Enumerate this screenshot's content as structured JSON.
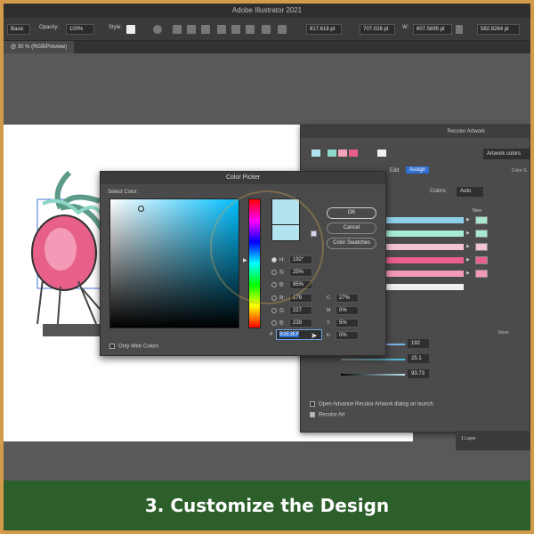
{
  "app": {
    "title": "Adobe Illustrator 2021"
  },
  "control_bar": {
    "brush_label": "Basic",
    "opacity_label": "Opacity:",
    "opacity_value": "100%",
    "style_label": "Style:",
    "x_value": "817.618 pt",
    "y_value": "707.028 pt",
    "w_label": "W:",
    "w_value": "607.5695 pt",
    "h_value": "582.8284 pt"
  },
  "doc_tab": {
    "label": "@ 30 % (RGB/Preview)"
  },
  "recolor": {
    "title": "Recolor Artwork",
    "artwork_colors": "Artwork colors",
    "tab_edit": "Edit",
    "tab_assign": "Assign",
    "color_group": "Color G",
    "colors_label": "Colors:",
    "colors_value": "Auto",
    "new_label": "New",
    "slider_values": [
      "192",
      "25.1",
      "93.73"
    ],
    "none_label": "None",
    "open_advance": "Open Advance Recolor Artwork dialog on launch",
    "recolor_art": "Recolor Art",
    "swatch_colors": [
      "#b3e3ef",
      "#8fd9c8",
      "#f5a3b8",
      "#e8608a",
      "#f0f0f0"
    ],
    "bar_colors": [
      "#8ecfea",
      "#a8ecd6",
      "#f3c3d3",
      "#ea5f8c",
      "#f39ab6",
      "#f0f0f0"
    ],
    "new_colors": [
      "#a8e8cf",
      "#a8e8cf",
      "#f3c3d3",
      "#ea5f8c",
      "#f39ab6"
    ]
  },
  "layers": {
    "label": "1 Layer"
  },
  "picker": {
    "title": "Color Picker",
    "select_color": "Select Color:",
    "ok": "OK",
    "cancel": "Cancel",
    "swatches": "Color Swatches",
    "h_label": "H:",
    "h_value": "192°",
    "s_label": "S:",
    "s_value": "25%",
    "b_label": "B:",
    "b_value": "95%",
    "r_label": "R:",
    "r_value": "179",
    "g_label": "G:",
    "g_value": "227",
    "bl_label": "B:",
    "bl_value": "239",
    "c_label": "C:",
    "c_value": "27%",
    "m_label": "M:",
    "m_value": "0%",
    "y_label": "Y:",
    "y_value": "5%",
    "k_label": "K:",
    "k_value": "0%",
    "hex_label": "#",
    "hex_value": "B3E3EF",
    "only_web": "Only Web Colors",
    "current_color": "#b3e3ef"
  },
  "caption": {
    "text": "3. Customize the Design"
  }
}
